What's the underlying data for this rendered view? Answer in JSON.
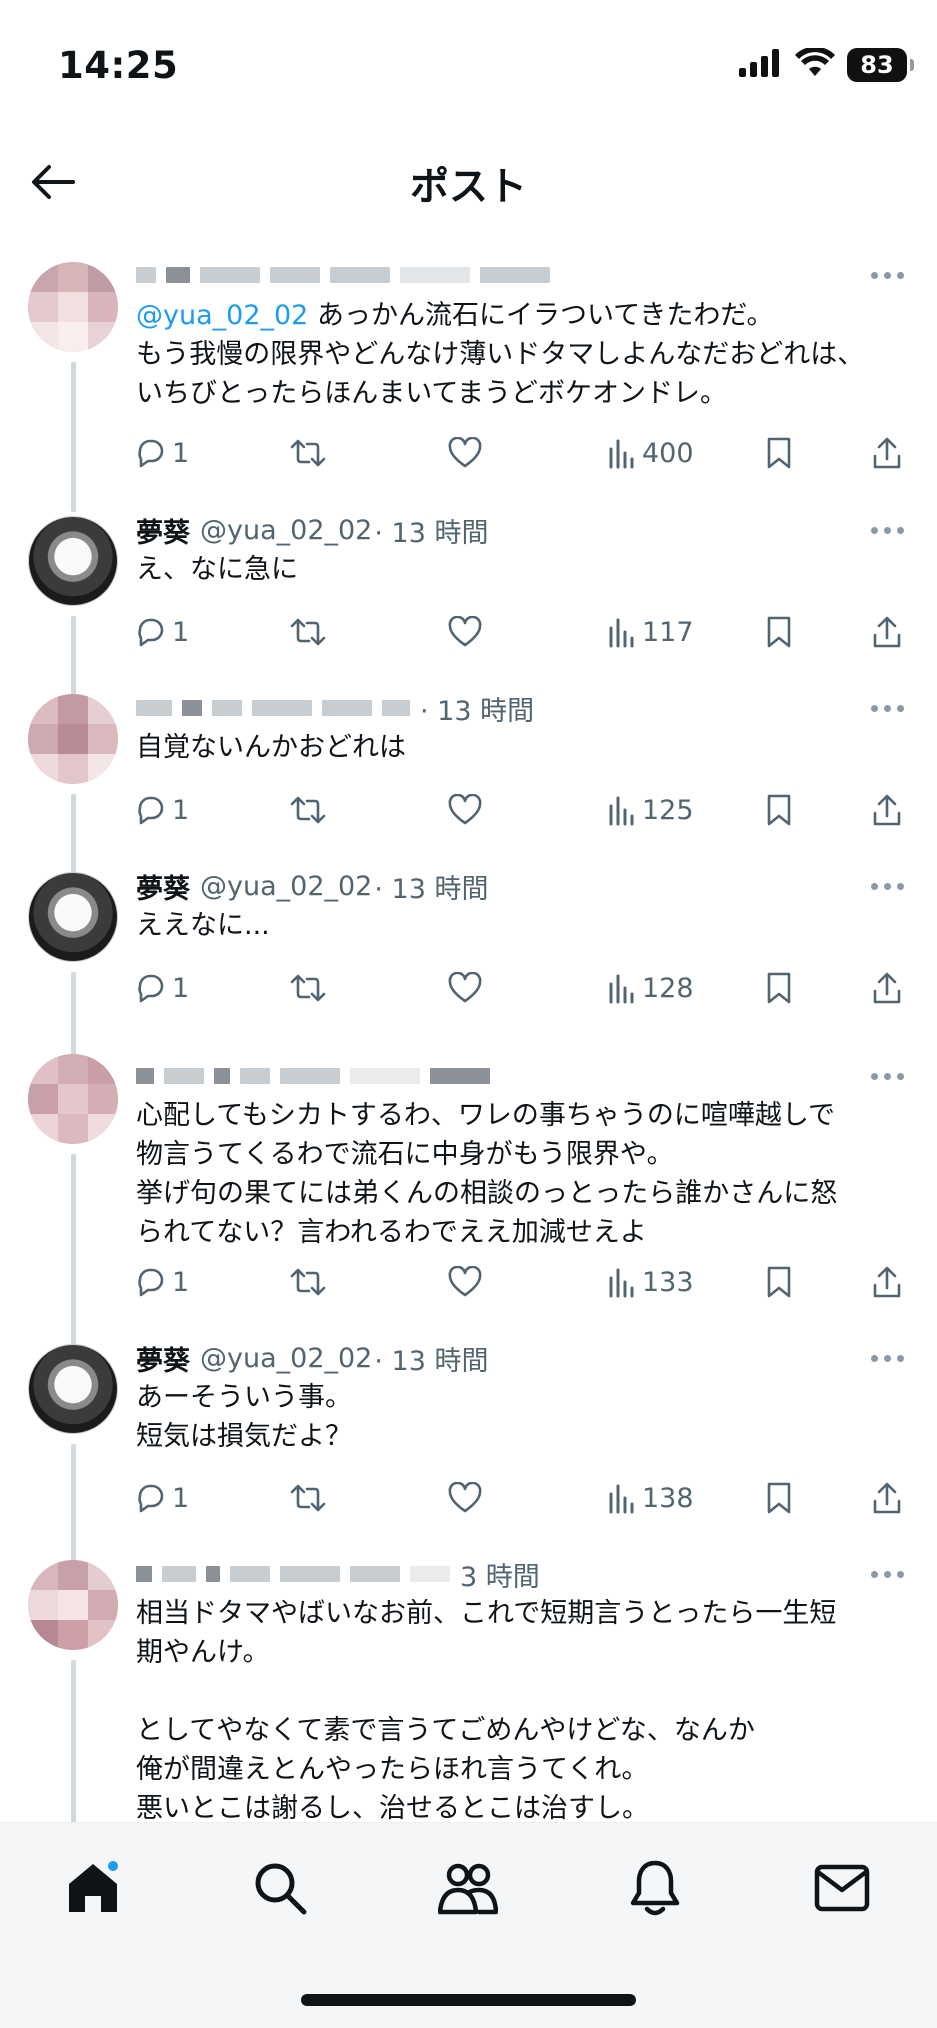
{
  "status": {
    "time": "14:25",
    "battery": "83"
  },
  "header": {
    "title": "ポスト"
  },
  "posts": [
    {
      "handle": "@yua_02_02",
      "text": " あっかん流石にイラついてきたわだ。\nもう我慢の限界やどんなけ薄いドタマしよんなだおどれは、\nいちびとったらほんまいてまうどボケオンドレ。",
      "replies": "1",
      "views": "400"
    },
    {
      "name": "夢葵",
      "handle": "@yua_02_02",
      "time": "· 13 時間",
      "text": "え、なに急に",
      "replies": "1",
      "views": "117"
    },
    {
      "time": "· 13 時間",
      "text": "自覚ないんかおどれは",
      "replies": "1",
      "views": "125"
    },
    {
      "name": "夢葵",
      "handle": "@yua_02_02",
      "time": "· 13 時間",
      "text": "ええなに...",
      "replies": "1",
      "views": "128"
    },
    {
      "text": "心配してもシカトするわ、ワレの事ちゃうのに喧嘩越しで\n物言うてくるわで流石に中身がもう限界や。\n挙げ句の果てには弟くんの相談のっとったら誰かさんに怒\nられてない？言われるわでええ加減せえよ",
      "replies": "1",
      "views": "133"
    },
    {
      "name": "夢葵",
      "handle": "@yua_02_02",
      "time": "· 13 時間",
      "text": "あーそういう事。\n短気は損気だよ？",
      "replies": "1",
      "views": "138"
    },
    {
      "time": "3 時間",
      "text": "相当ドタマやばいなお前、これで短期言うとったら一生短\n期やんけ。\n\nとしてやなくて素で言うてごめんやけどな、なんか\n俺が間違えとんやったらほれ言うてくれ。\n悪いとこは謝るし、治せるとこは治すし。"
    }
  ],
  "tabs": [
    "home",
    "search",
    "communities",
    "notifications",
    "messages"
  ],
  "colors": {
    "accent": "#1d9bf0",
    "text": "#0f1419",
    "secondary": "#536471",
    "thread_line": "#cfd9de"
  }
}
